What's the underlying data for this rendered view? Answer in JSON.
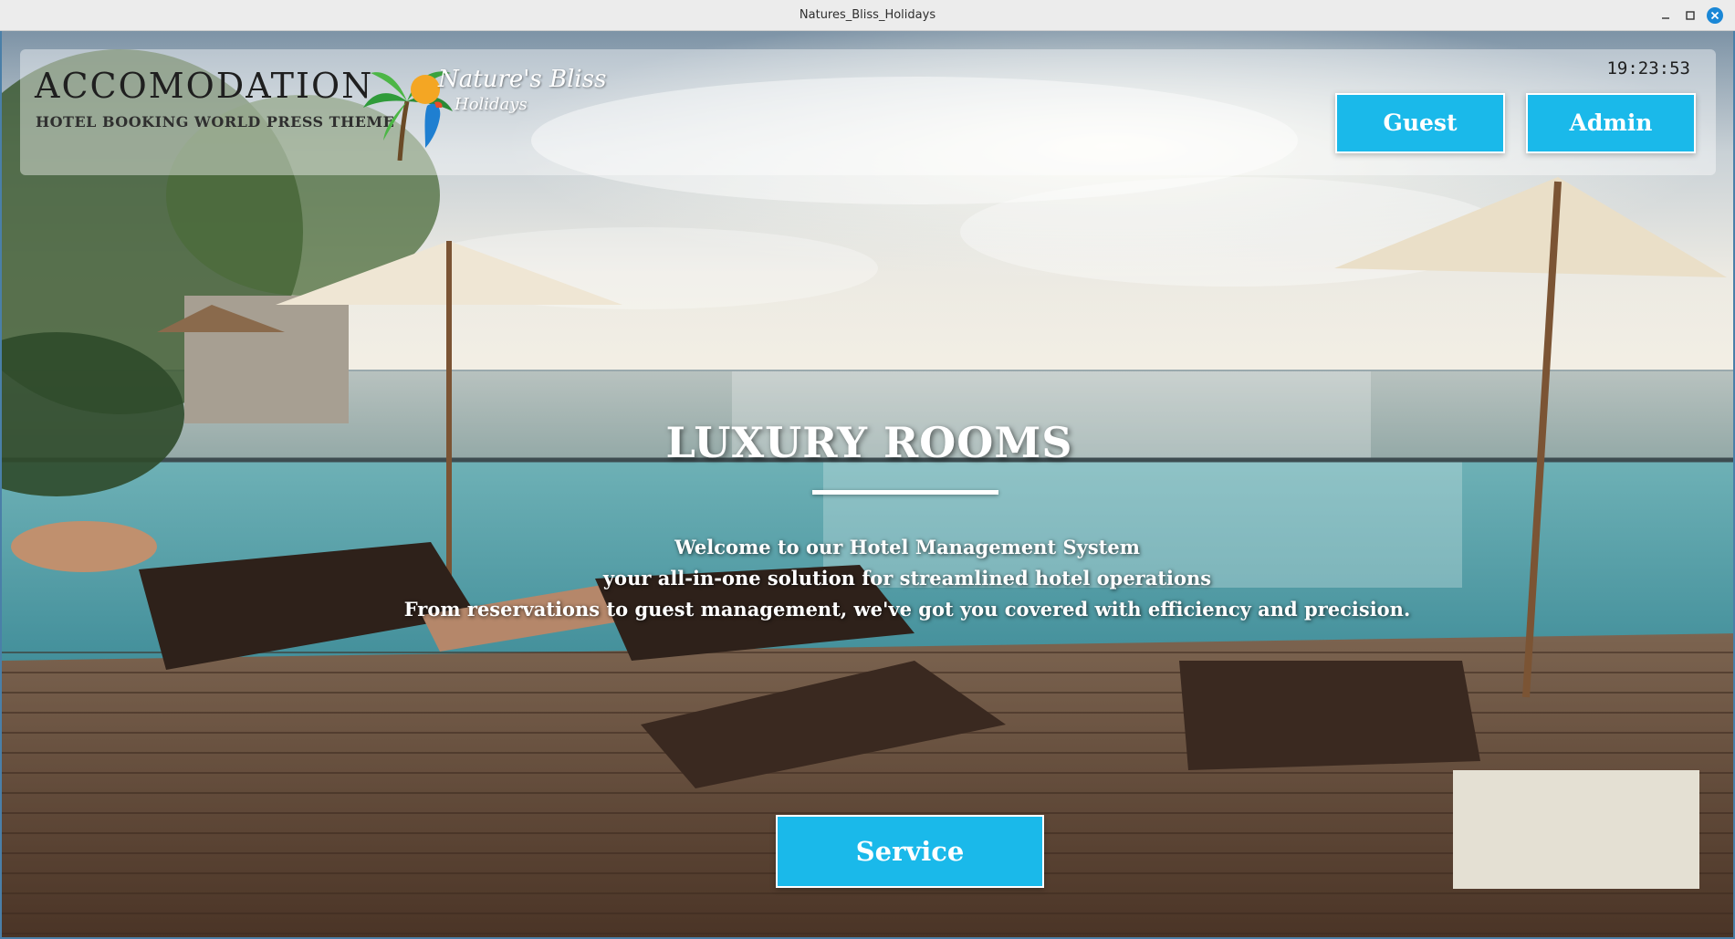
{
  "window": {
    "title": "Natures_Bliss_Holidays"
  },
  "header": {
    "brand_title": "ACCOMODATION",
    "brand_subtitle": "HOTEL BOOKING WORLD PRESS THEME",
    "logo_line1": "Nature's Bliss",
    "logo_line2": "Holidays",
    "clock": "19:23:53",
    "guest_label": "Guest",
    "admin_label": "Admin"
  },
  "hero": {
    "title": "LUXURY ROOMS",
    "lines": [
      "Welcome to our Hotel Management System",
      "your all-in-one solution for streamlined hotel operations",
      "From reservations to guest management, we've got you covered with efficiency and precision."
    ],
    "service_label": "Service"
  },
  "colors": {
    "button": "#1ab9ea",
    "button_text": "#ffffff",
    "close_control": "#1a87d6"
  },
  "icons": {
    "minimize": "minimize-icon",
    "maximize": "maximize-icon",
    "close": "close-icon",
    "logo": "palm-tree-parrot-logo"
  }
}
